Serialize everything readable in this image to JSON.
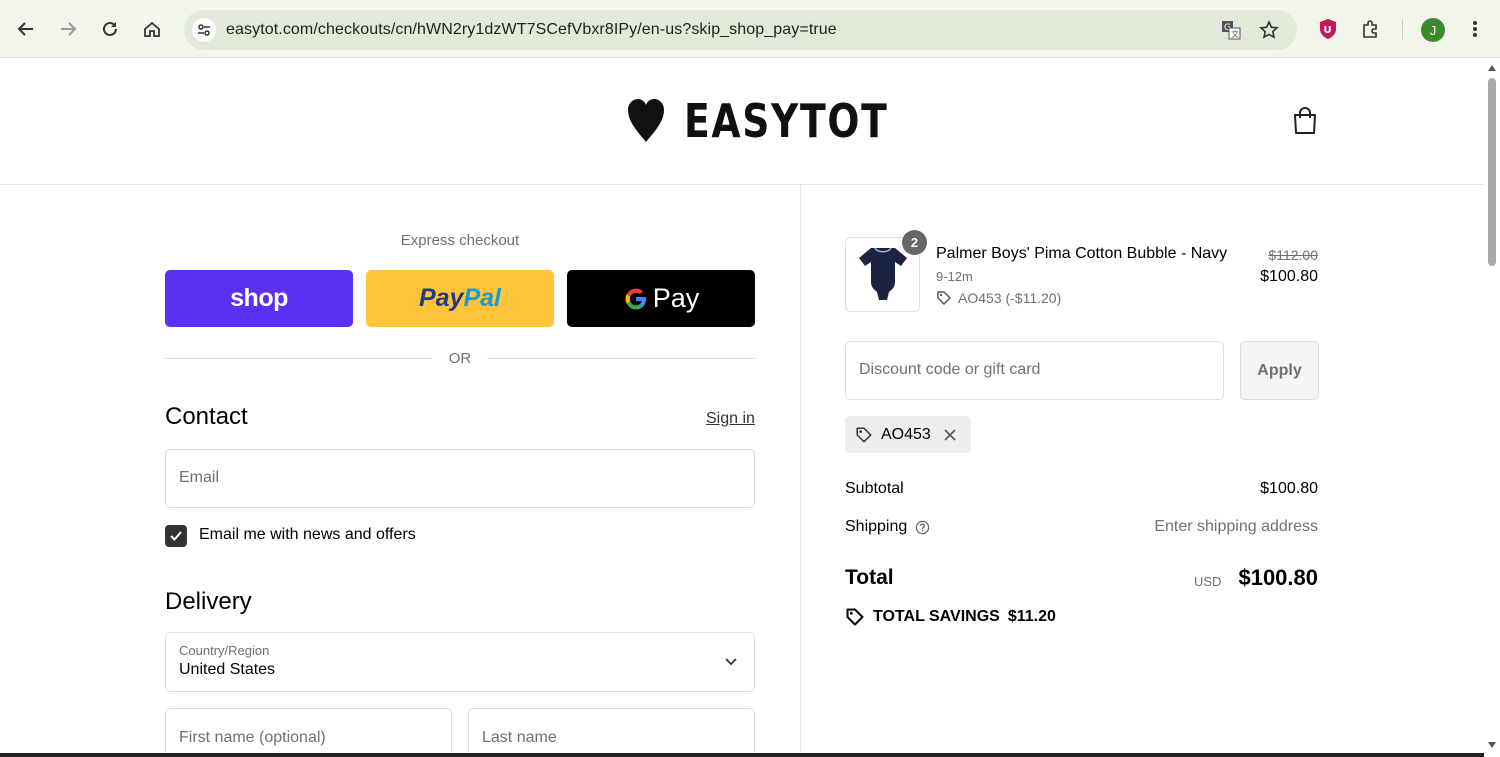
{
  "browser": {
    "url": "easytot.com/checkouts/cn/hWN2ry1dzWT7SCefVbxr8IPy/en-us?skip_shop_pay=true",
    "profile_initial": "J"
  },
  "store": {
    "name": "EASYTOT"
  },
  "express": {
    "label": "Express checkout",
    "shop_label": "shop",
    "paypal_label": "PayPal",
    "gpay_label": "Pay",
    "or_label": "OR"
  },
  "contact": {
    "title": "Contact",
    "signin_label": "Sign in",
    "email_placeholder": "Email",
    "newsletter_label": "Email me with news and offers",
    "newsletter_checked": true
  },
  "delivery": {
    "title": "Delivery",
    "country_label": "Country/Region",
    "country_value": "United States",
    "first_name_placeholder": "First name (optional)",
    "last_name_placeholder": "Last name"
  },
  "order": {
    "item": {
      "name": "Palmer Boys' Pima Cotton Bubble - Navy",
      "variant": "9-12m",
      "discount": "AO453 (-$11.20)",
      "quantity": "2",
      "price_original": "$112.00",
      "price_final": "$100.80"
    },
    "discount_placeholder": "Discount code or gift card",
    "apply_label": "Apply",
    "applied_code": "AO453",
    "subtotal_label": "Subtotal",
    "subtotal_value": "$100.80",
    "shipping_label": "Shipping",
    "shipping_value": "Enter shipping address",
    "total_label": "Total",
    "currency": "USD",
    "total_value": "$100.80",
    "savings_label": "TOTAL SAVINGS",
    "savings_value": "$11.20"
  },
  "colors": {
    "shop_pay": "#5a31f4",
    "paypal": "#ffc439",
    "gpay": "#000000"
  }
}
